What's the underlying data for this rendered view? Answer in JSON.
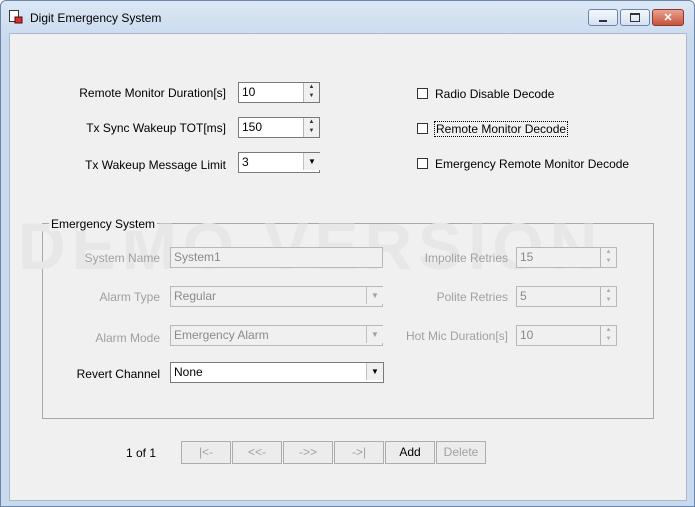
{
  "window": {
    "title": "Digit Emergency System"
  },
  "settings": {
    "remote_monitor_duration": {
      "label": "Remote Monitor Duration[s]",
      "value": "10"
    },
    "tx_sync_wakeup_tot": {
      "label": "Tx Sync Wakeup TOT[ms]",
      "value": "150"
    },
    "tx_wakeup_message_limit": {
      "label": "Tx Wakeup Message Limit",
      "value": "3"
    },
    "radio_disable_decode": {
      "label": "Radio Disable Decode",
      "checked": false
    },
    "remote_monitor_decode": {
      "label": "Remote Monitor Decode",
      "checked": false
    },
    "emergency_remote_monitor_decode": {
      "label": "Emergency Remote Monitor Decode",
      "checked": false
    }
  },
  "emergency_system": {
    "group_title": "Emergency System",
    "watermark": "DEMO VERSION",
    "system_name": {
      "label": "System Name",
      "value": "System1"
    },
    "alarm_type": {
      "label": "Alarm Type",
      "value": "Regular"
    },
    "alarm_mode": {
      "label": "Alarm Mode",
      "value": "Emergency Alarm"
    },
    "revert_channel": {
      "label": "Revert Channel",
      "value": "None"
    },
    "impolite_retries": {
      "label": "Impolite Retries",
      "value": "15"
    },
    "polite_retries": {
      "label": "Polite Retries",
      "value": "5"
    },
    "hot_mic_duration": {
      "label": "Hot Mic Duration[s]",
      "value": "10"
    }
  },
  "navigation": {
    "record_position": "1 of 1",
    "first": "|<-",
    "prev": "<<-",
    "next": "->>",
    "last": "->|",
    "add": "Add",
    "delete": "Delete"
  },
  "icons": {
    "app": "app-window-icon",
    "minimize": "minimize-icon",
    "maximize": "maximize-icon",
    "close": "close-icon"
  },
  "colors": {
    "client_bg": "#f0f0f0",
    "disabled_text": "#a0a0a0",
    "titlebar": "#c9daee"
  }
}
